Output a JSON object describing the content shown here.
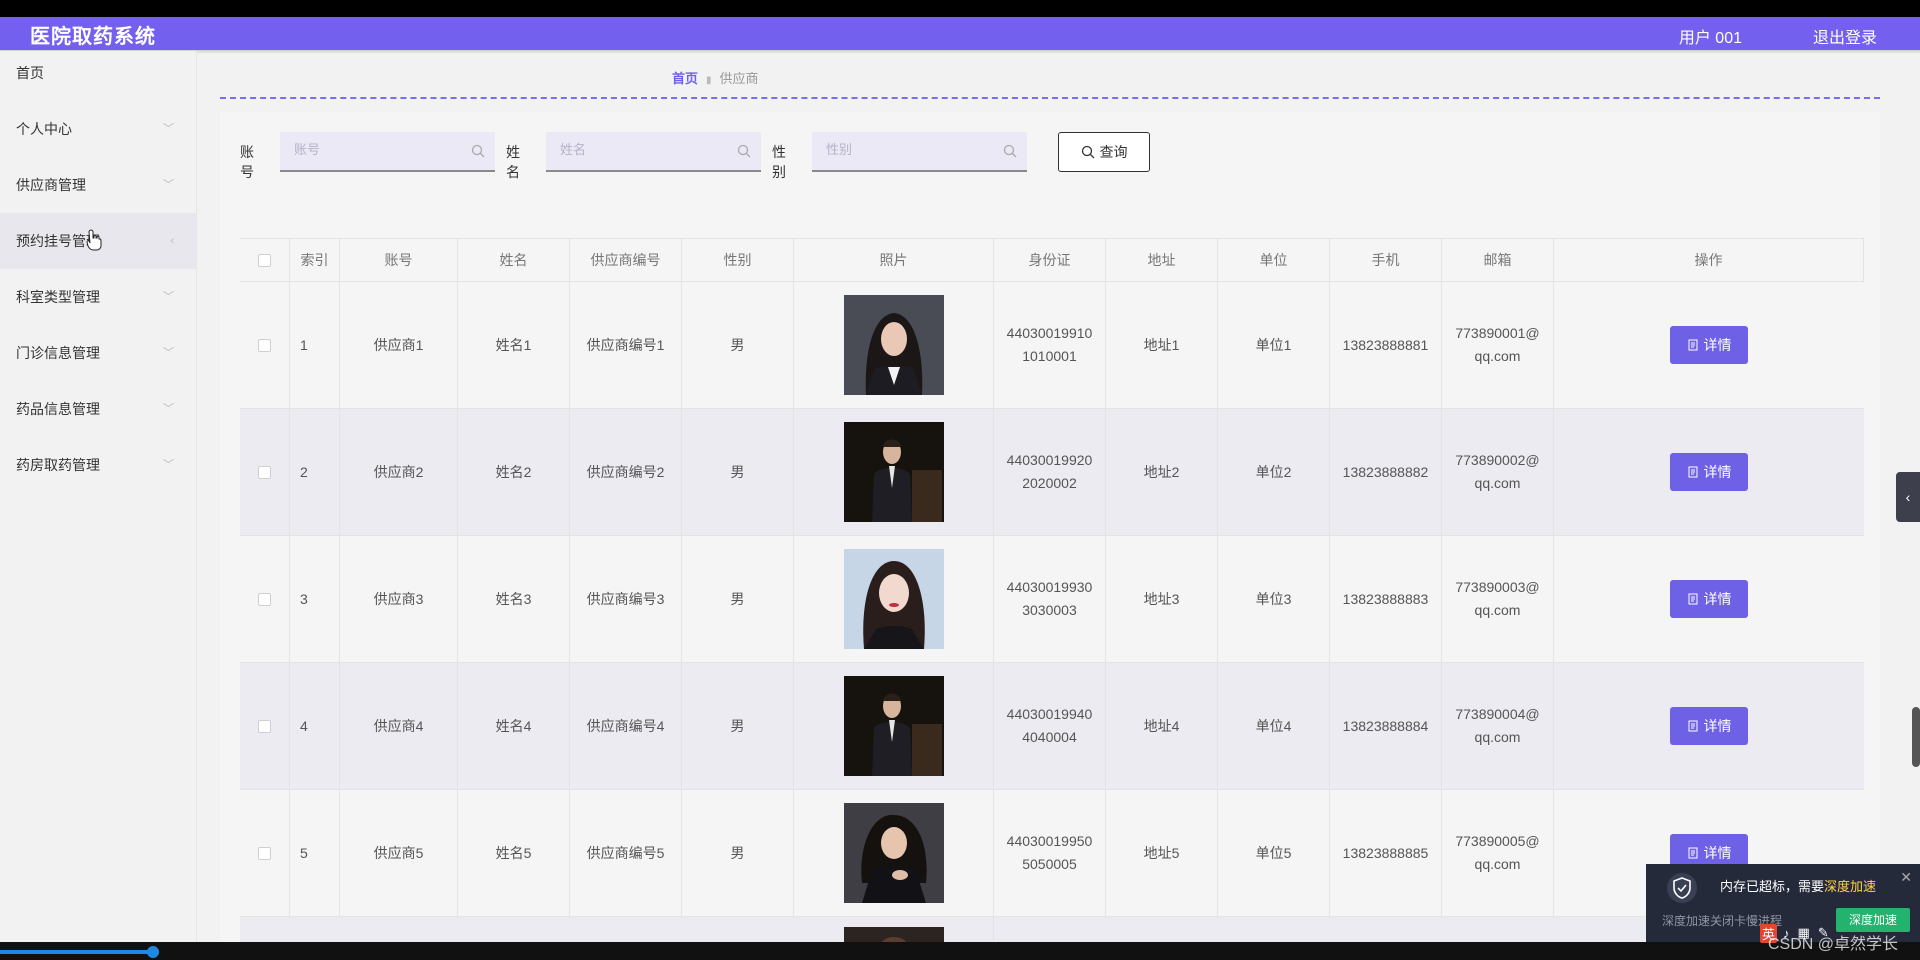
{
  "header": {
    "title": "医院取药系统",
    "user": "用户 001",
    "logout": "退出登录"
  },
  "sidebar": {
    "items": [
      {
        "label": "首页",
        "expandable": false
      },
      {
        "label": "个人中心",
        "expandable": true
      },
      {
        "label": "供应商管理",
        "expandable": true
      },
      {
        "label": "预约挂号管理",
        "expandable": true,
        "active": true
      },
      {
        "label": "科室类型管理",
        "expandable": true
      },
      {
        "label": "门诊信息管理",
        "expandable": true
      },
      {
        "label": "药品信息管理",
        "expandable": true
      },
      {
        "label": "药房取药管理",
        "expandable": true
      }
    ]
  },
  "breadcrumb": {
    "home": "首页",
    "current": "供应商"
  },
  "search": {
    "fields": [
      {
        "label": "账号",
        "placeholder": "账号"
      },
      {
        "label": "姓名",
        "placeholder": "姓名"
      },
      {
        "label": "性别",
        "placeholder": "性别"
      }
    ],
    "button": "查询"
  },
  "table": {
    "columns": [
      "索引",
      "账号",
      "姓名",
      "供应商编号",
      "性别",
      "照片",
      "身份证",
      "地址",
      "单位",
      "手机",
      "邮箱",
      "操作"
    ],
    "action_label": "详情",
    "rows": [
      {
        "index": "1",
        "account": "供应商1",
        "name": "姓名1",
        "code": "供应商编号1",
        "gender": "男",
        "photo": "woman-long-hair",
        "id_card": [
          "44030019910",
          "1010001"
        ],
        "address": "地址1",
        "unit": "单位1",
        "phone": "13823888881",
        "email": [
          "773890001@",
          "qq.com"
        ]
      },
      {
        "index": "2",
        "account": "供应商2",
        "name": "姓名2",
        "code": "供应商编号2",
        "gender": "男",
        "photo": "man-suit",
        "id_card": [
          "44030019920",
          "2020002"
        ],
        "address": "地址2",
        "unit": "单位2",
        "phone": "13823888882",
        "email": [
          "773890002@",
          "qq.com"
        ]
      },
      {
        "index": "3",
        "account": "供应商3",
        "name": "姓名3",
        "code": "供应商编号3",
        "gender": "男",
        "photo": "woman-light",
        "id_card": [
          "44030019930",
          "3030003"
        ],
        "address": "地址3",
        "unit": "单位3",
        "phone": "13823888883",
        "email": [
          "773890003@",
          "qq.com"
        ]
      },
      {
        "index": "4",
        "account": "供应商4",
        "name": "姓名4",
        "code": "供应商编号4",
        "gender": "男",
        "photo": "man-suit",
        "id_card": [
          "44030019940",
          "4040004"
        ],
        "address": "地址4",
        "unit": "单位4",
        "phone": "13823888884",
        "email": [
          "773890004@",
          "qq.com"
        ]
      },
      {
        "index": "5",
        "account": "供应商5",
        "name": "姓名5",
        "code": "供应商编号5",
        "gender": "男",
        "photo": "woman-curly",
        "id_card": [
          "44030019950",
          "5050005"
        ],
        "address": "地址5",
        "unit": "单位5",
        "phone": "13823888885",
        "email": [
          "773890005@",
          "qq.com"
        ]
      }
    ]
  },
  "popup": {
    "message_prefix": "内存已超标，需要",
    "message_highlight": "深度加速",
    "sub": "深度加速关闭卡慢进程",
    "action": "深度加速"
  },
  "tray": [
    "英",
    "♪",
    "▦",
    "✎"
  ],
  "watermark": "CSDN @卓然学长",
  "colors": {
    "primary": "#7460ee",
    "button": "#6e61e6",
    "link": "#6f5ff0"
  }
}
